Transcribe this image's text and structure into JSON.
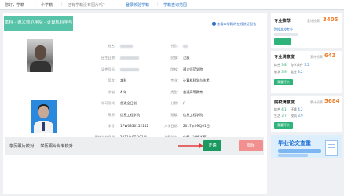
{
  "topbar": {
    "home": "您好，学籍",
    "sep1": "|",
    "tab1": "个学籍",
    "sep2": "|",
    "notice": "还有学籍没有图片吗？",
    "link1": "登录校验学籍",
    "sep3": "|",
    "link2": "学籍查询范围"
  },
  "ribbon": "本科 - 遵义师范学院 - 计算机科学与技术",
  "verify_link": "查看本学籍的在线验证报告",
  "fields_left": [
    {
      "label": "姓名：",
      "value": ""
    },
    {
      "label": "出生日期：",
      "value": ""
    },
    {
      "label": "证件号码：",
      "value": ""
    },
    {
      "label": "层次：",
      "value": "本科"
    },
    {
      "label": "学制：",
      "value": "4 年"
    },
    {
      "label": "学习形式：",
      "value": "普通全日制"
    },
    {
      "label": "系所：",
      "value": "信息工程学院"
    },
    {
      "label": "学号：",
      "value": "17W0830152142"
    },
    {
      "label": "预计毕业日期：",
      "value": "2021年07月01日"
    }
  ],
  "fields_right": [
    {
      "label": "性别：",
      "value": ""
    },
    {
      "label": "民族：",
      "value": "汉族"
    },
    {
      "label": "院校：",
      "value": "遵义师范学院"
    },
    {
      "label": "专业：",
      "value": "计算机科学与技术"
    },
    {
      "label": "类型：",
      "value": "普通高等教育"
    },
    {
      "label": "分院：",
      "value": "/"
    },
    {
      "label": "班级：",
      "value": "信息工程学院"
    },
    {
      "label": "入学日期：",
      "value": "2017年09月01日"
    },
    {
      "label": "学籍状态：",
      "value": "在籍（注册学籍）"
    }
  ],
  "bottom": {
    "question": "学历照片校对：",
    "hint": "学历照片尚未校对",
    "ok_button": "正确",
    "error_button": "有误"
  },
  "sidebar": {
    "card1": {
      "title": "专业推荐",
      "count_label": "累计投票",
      "count": "3405",
      "line": "院校本校专业"
    },
    "card2": {
      "title": "专业满意度",
      "count_label": "累计投票",
      "count": "643",
      "rows": [
        [
          "综合",
          "3.8",
          "办学条件",
          "3.5"
        ],
        [
          "教学",
          "3.9",
          "就业",
          "3.2"
        ]
      ],
      "btn": "我要评价"
    },
    "card3": {
      "title": "院校满意度",
      "count_label": "累计投票",
      "count": "5684",
      "rows": [
        [
          "综合",
          "4.1",
          "环境",
          "4.2"
        ],
        [
          "生活",
          "3.7",
          "校风",
          "3.9"
        ]
      ],
      "btn": "我要评价"
    },
    "banner": "毕业论文查重"
  },
  "colors": {
    "accent_green": "#57c3a9",
    "ok_green": "#1a9a61",
    "error_red": "#f1908f",
    "link_blue": "#2e76c8",
    "orange": "#f07b26"
  }
}
